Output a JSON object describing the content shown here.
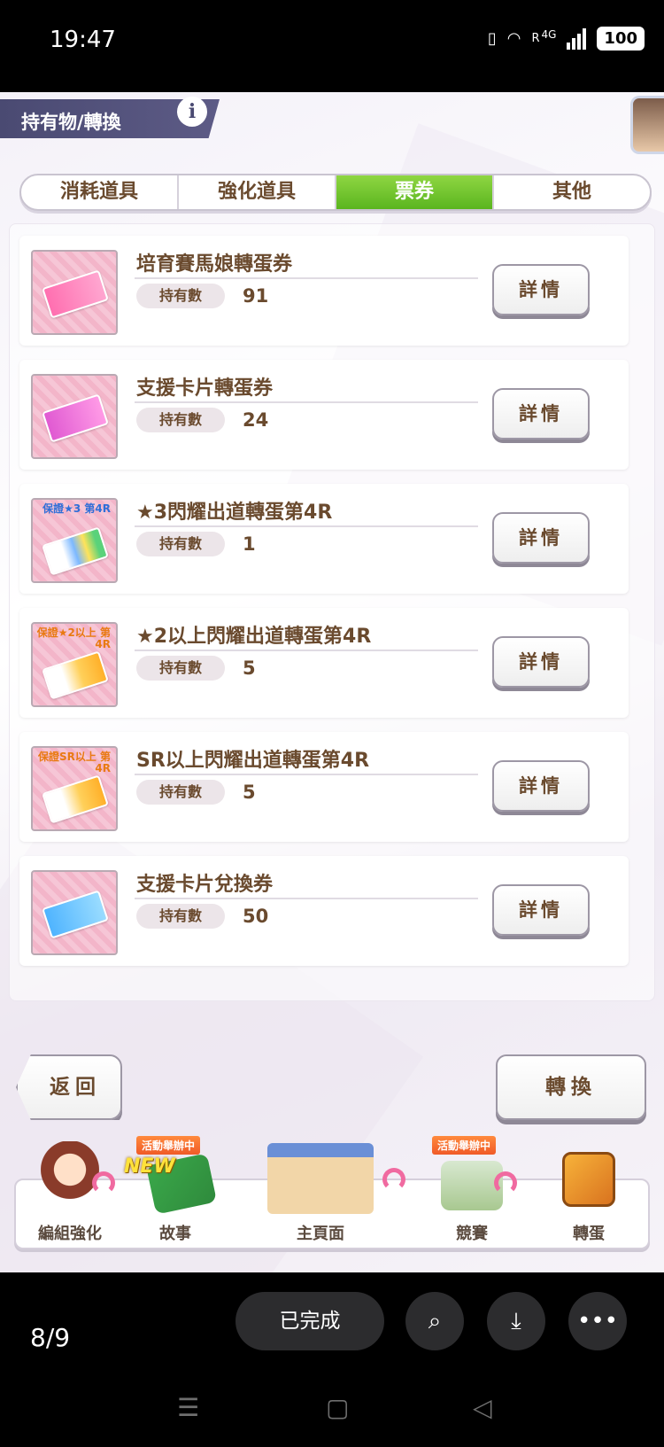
{
  "status_bar": {
    "time": "19:47",
    "network": "4G",
    "roaming": "R",
    "battery": "100"
  },
  "header": {
    "title": "持有物/轉換",
    "info_label": "i"
  },
  "tabs": [
    {
      "label": "消耗道具",
      "active": false
    },
    {
      "label": "強化道具",
      "active": false
    },
    {
      "label": "票券",
      "active": true
    },
    {
      "label": "其他",
      "active": false
    }
  ],
  "items": [
    {
      "name": "培育賽馬娘轉蛋券",
      "qty_label": "持有數",
      "qty": "91",
      "detail": "詳情",
      "icon": "pink-ticket-icon"
    },
    {
      "name": "支援卡片轉蛋券",
      "qty_label": "持有數",
      "qty": "24",
      "detail": "詳情",
      "icon": "magenta-ticket-icon"
    },
    {
      "name": "★3閃耀出道轉蛋第4R",
      "qty_label": "持有數",
      "qty": "1",
      "detail": "詳情",
      "icon": "rainbow-ticket-icon",
      "tag": "保證★3 第4R"
    },
    {
      "name": "★2以上閃耀出道轉蛋第4R",
      "qty_label": "持有數",
      "qty": "5",
      "detail": "詳情",
      "icon": "gold-ticket-icon",
      "tag": "保證★2以上 第4R"
    },
    {
      "name": "SR以上閃耀出道轉蛋第4R",
      "qty_label": "持有數",
      "qty": "5",
      "detail": "詳情",
      "icon": "gold-ticket-icon",
      "tag": "保證SR以上 第4R"
    },
    {
      "name": "支援卡片兌換券",
      "qty_label": "持有數",
      "qty": "50",
      "detail": "詳情",
      "icon": "blue-ticket-icon"
    }
  ],
  "actions": {
    "back": "返回",
    "convert": "轉換"
  },
  "nav": {
    "items": [
      {
        "label": "編組強化"
      },
      {
        "label": "故事",
        "badge": "活動舉辦中",
        "new": "NEW"
      },
      {
        "label": "主頁面"
      },
      {
        "label": "競賽",
        "badge": "活動舉辦中"
      },
      {
        "label": "轉蛋"
      }
    ]
  },
  "viewer": {
    "count": "8/9",
    "done": "已完成"
  },
  "colors": {
    "tab_active": "#6cc12a",
    "text_brown": "#6a4a2e",
    "banner": "#4a4a72"
  }
}
